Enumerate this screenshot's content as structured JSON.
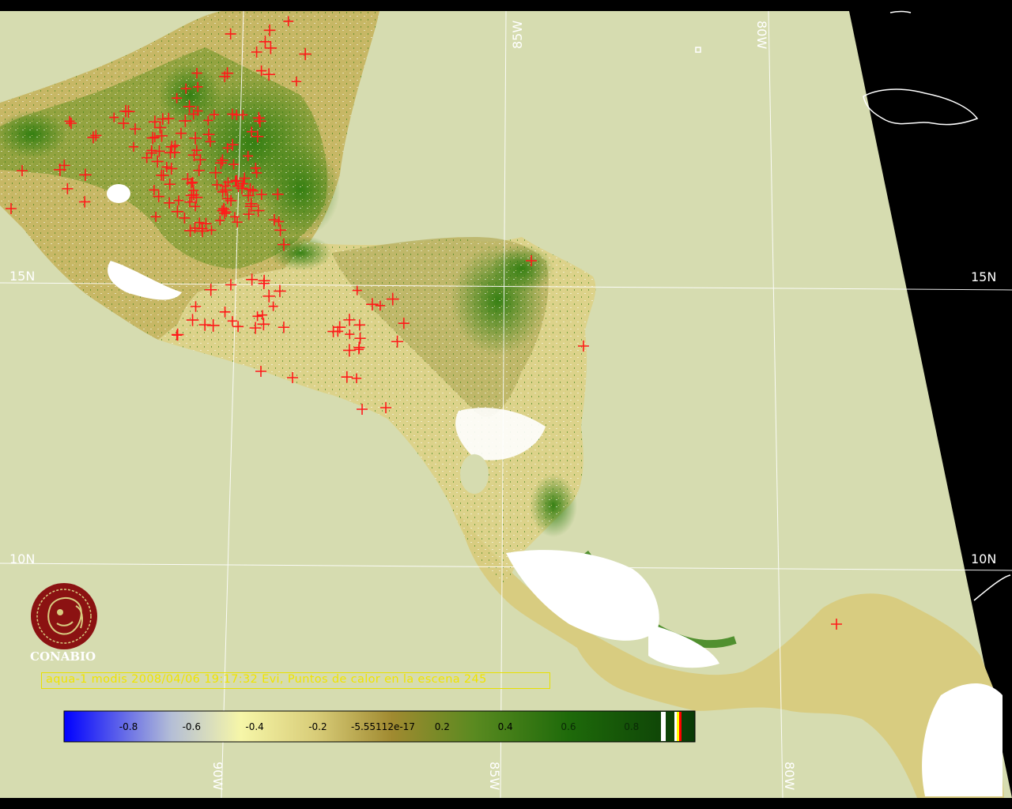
{
  "colors": {
    "sea": "#d6dcb0",
    "background": "#000000",
    "grid": "#ffffff",
    "fire_marker": "#ff1a1a",
    "caption": "#f0e400",
    "logo": "#8b1212",
    "veg_dense": "#2f7d0f",
    "veg_medium": "#8aa03a",
    "veg_sparse": "#e4dc9a",
    "cloud": "#ffffff"
  },
  "grid_labels": {
    "lat_15_left": "15N",
    "lat_15_right": "15N",
    "lat_10_left": "10N",
    "lat_10_right": "10N",
    "lon_85_top": "85W",
    "lon_80_top": "80W",
    "lon_90_bottom": "90W",
    "lon_85_bottom": "85W",
    "lon_80_bottom": "80W"
  },
  "logo": {
    "text": "CONABIO",
    "icon": "conabio-mask-logo"
  },
  "caption": {
    "text": "aqua-1 modis 2008/04/06 19:17:32 Evi, Puntos de calor en la escena 245"
  },
  "colorbar": {
    "ticks": [
      "-0.8",
      "-0.6",
      "-0.4",
      "-0.2",
      "-5.55112e-17",
      "0.2",
      "0.4",
      "0.6",
      "0.8"
    ],
    "tick_values": [
      -0.8,
      -0.6,
      -0.4,
      -0.2,
      0.0,
      0.2,
      0.4,
      0.6,
      0.8
    ],
    "range": [
      -1.0,
      1.0
    ],
    "stops": [
      "#0000ff",
      "#b4bed6",
      "#f6f6a8",
      "#c8b860",
      "#a08a30",
      "#5a8a20",
      "#1e6a0a",
      "#0a3a06"
    ],
    "end_markers": [
      "#ffffff",
      "#ffffff",
      "#ffff00",
      "#ff0000"
    ]
  },
  "map": {
    "type": "satellite EVI composite with hotspot markers",
    "hotspot_count": 245,
    "marker_icon": "plus-marker"
  }
}
